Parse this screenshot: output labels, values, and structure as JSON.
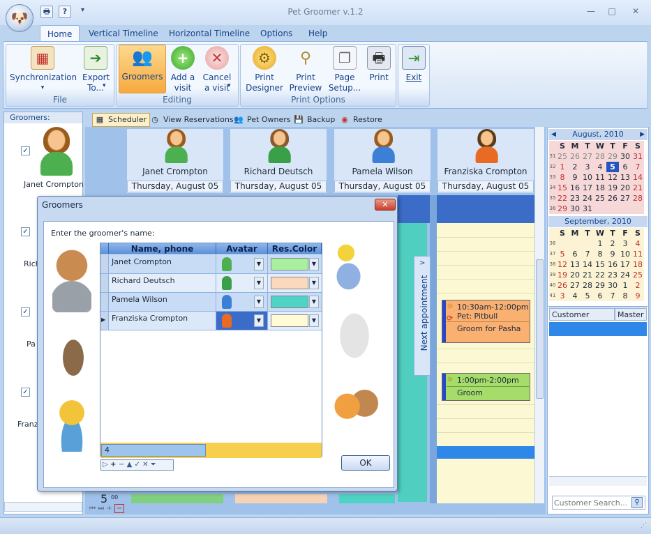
{
  "app": {
    "title": "Pet Groomer v.1.2"
  },
  "window_controls": {
    "minimize": "—",
    "maximize": "□",
    "close": "✕"
  },
  "quick_access": {
    "print": "🖶",
    "help": "?",
    "more": "▾"
  },
  "ribbon_tabs": [
    "Home",
    "Vertical Timeline",
    "Horizontal Timeline",
    "Options",
    "Help"
  ],
  "ribbon": {
    "groups": {
      "file": "File",
      "editing": "Editing",
      "print": "Print Options"
    },
    "sync": "Synchronization",
    "sync_arrow": "▾",
    "export": "Export To...",
    "export_arrow": "▾",
    "groomers": "Groomers",
    "add_visit": "Add a visit",
    "cancel_visit": "Cancel a visit",
    "cancel_arrow": "▾",
    "print_designer": "Print Designer",
    "print_preview": "Print Preview",
    "page_setup": "Page Setup...",
    "print": "Print",
    "exit": "Exit"
  },
  "groomers_panel": {
    "title": "Groomers:",
    "first_name": "Janet Crompton",
    "partial_names": [
      "Rich",
      "Pa",
      "Franz"
    ]
  },
  "schedule_tabs": [
    "Scheduler",
    "View Reservations",
    "Pet Owners",
    "Backup",
    "Restore"
  ],
  "schedule": {
    "groomers": [
      {
        "name": "Janet Crompton",
        "date": "Thursday, August 05"
      },
      {
        "name": "Richard Deutsch",
        "date": "Thursday, August 05"
      },
      {
        "name": "Pamela Wilson",
        "date": "Thursday, August 05"
      },
      {
        "name": "Franziska Crompton",
        "date": "Thursday, August 05"
      }
    ],
    "next_appointment": "Next appointment",
    "time_label": "5",
    "time_min": "00",
    "appointments": [
      {
        "time": "10:30am-12:00pm",
        "pet": "Pet: Pitbull",
        "desc": "Groom for Pasha",
        "color": "#f9b070"
      },
      {
        "time": "1:00pm-2:00pm",
        "desc": "Groom",
        "color": "#a6dc6a"
      }
    ]
  },
  "calendar": {
    "august": {
      "title": "August, 2010",
      "days": [
        "S",
        "M",
        "T",
        "W",
        "T",
        "F",
        "S"
      ],
      "weeks": [
        {
          "wk": "31",
          "d": [
            "25",
            "26",
            "27",
            "28",
            "29",
            "30",
            "31"
          ]
        },
        {
          "wk": "32",
          "d": [
            "1",
            "2",
            "3",
            "4",
            "5",
            "6",
            "7"
          ]
        },
        {
          "wk": "33",
          "d": [
            "8",
            "9",
            "10",
            "11",
            "12",
            "13",
            "14"
          ]
        },
        {
          "wk": "34",
          "d": [
            "15",
            "16",
            "17",
            "18",
            "19",
            "20",
            "21"
          ]
        },
        {
          "wk": "35",
          "d": [
            "22",
            "23",
            "24",
            "25",
            "26",
            "27",
            "28"
          ]
        },
        {
          "wk": "36",
          "d": [
            "29",
            "30",
            "31",
            "",
            "",
            "",
            ""
          ]
        }
      ]
    },
    "september": {
      "title": "September, 2010",
      "days": [
        "S",
        "M",
        "T",
        "W",
        "T",
        "F",
        "S"
      ],
      "weeks": [
        {
          "wk": "36",
          "d": [
            "",
            "",
            "",
            "1",
            "2",
            "3",
            "4"
          ]
        },
        {
          "wk": "37",
          "d": [
            "5",
            "6",
            "7",
            "8",
            "9",
            "10",
            "11"
          ]
        },
        {
          "wk": "38",
          "d": [
            "12",
            "13",
            "14",
            "15",
            "16",
            "17",
            "18"
          ]
        },
        {
          "wk": "39",
          "d": [
            "19",
            "20",
            "21",
            "22",
            "23",
            "24",
            "25"
          ]
        },
        {
          "wk": "40",
          "d": [
            "26",
            "27",
            "28",
            "29",
            "30",
            "1",
            "2"
          ]
        },
        {
          "wk": "41",
          "d": [
            "3",
            "4",
            "5",
            "6",
            "7",
            "8",
            "9"
          ]
        }
      ]
    }
  },
  "customer_table": {
    "col1": "Customer",
    "col2": "Master"
  },
  "customer_search": {
    "placeholder": "Customer Search..."
  },
  "dialog": {
    "title": "Groomers",
    "close": "✕",
    "prompt": "Enter the groomer's name:",
    "columns": {
      "name": "Name, phone",
      "avatar": "Avatar",
      "color": "Res.Color"
    },
    "rows": [
      {
        "name": "Janet Crompton",
        "color": "#a8f0a0"
      },
      {
        "name": "Richard Deutsch",
        "color": "#fbd9bc"
      },
      {
        "name": "Pamela Wilson",
        "color": "#4fd3c4"
      },
      {
        "name": "Franziska Crompton",
        "color": "#fffbd6"
      }
    ],
    "count": "4",
    "ok": "OK"
  }
}
